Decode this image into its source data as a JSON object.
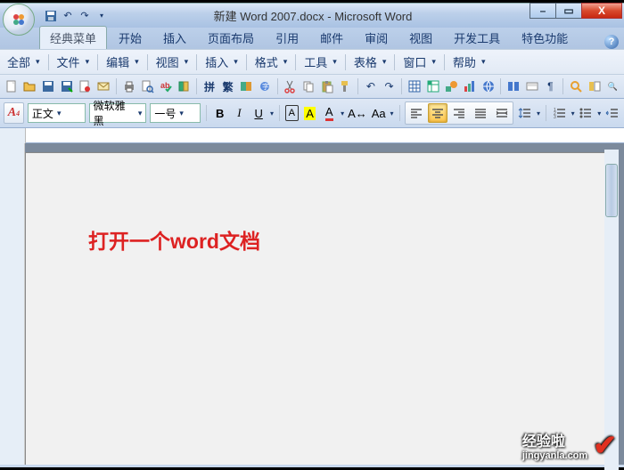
{
  "titlebar": {
    "title": "新建 Word 2007.docx - Microsoft Word"
  },
  "qat": {
    "save": "💾",
    "undo": "↶",
    "redo": "↷"
  },
  "tabs": {
    "items": [
      {
        "label": "经典菜单",
        "active": true
      },
      {
        "label": "开始"
      },
      {
        "label": "插入"
      },
      {
        "label": "页面布局"
      },
      {
        "label": "引用"
      },
      {
        "label": "邮件"
      },
      {
        "label": "审阅"
      },
      {
        "label": "视图"
      },
      {
        "label": "开发工具"
      },
      {
        "label": "特色功能"
      }
    ]
  },
  "submenu": [
    "全部",
    "文件",
    "编辑",
    "视图",
    "插入",
    "格式",
    "工具",
    "表格",
    "窗口",
    "帮助"
  ],
  "format": {
    "aa_btn": "A",
    "style": "正文",
    "font": "微软雅黑",
    "size": "一号",
    "bold": "B",
    "italic": "I",
    "underline": "U",
    "border_a": "A",
    "highlight_a": "A",
    "fontcolor_a": "A",
    "charscale": "A",
    "case": "Aa"
  },
  "document": {
    "content": "打开一个word文档"
  },
  "watermark": {
    "main": "经验啦",
    "sub": "jingyanla.com",
    "check": "✔"
  },
  "controls": {
    "min": "–",
    "max": "▭",
    "close": "X"
  }
}
